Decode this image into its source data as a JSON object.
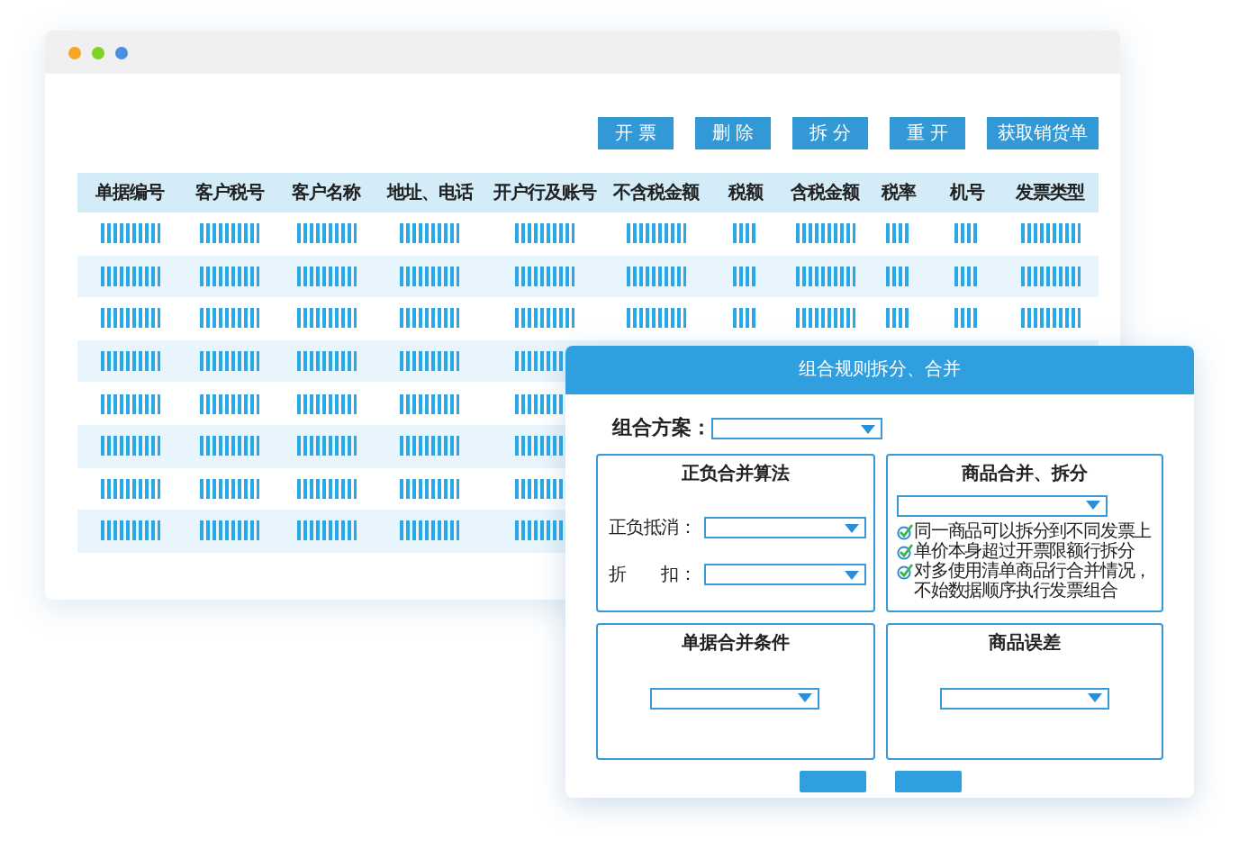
{
  "window": {
    "controls": [
      {
        "color": "#f5a623"
      },
      {
        "color": "#7ed321"
      },
      {
        "color": "#4a90e2"
      }
    ]
  },
  "toolbar": {
    "buttons": [
      "开 票",
      "删 除",
      "拆 分",
      "重 开",
      "获取销货单"
    ]
  },
  "table": {
    "columns": [
      "单据编号",
      "客户税号",
      "客户名称",
      "地址、电话",
      "开户行及账号",
      "不含税金额",
      "税额",
      "含税金额",
      "税率",
      "机号",
      "发票类型"
    ],
    "rows": [
      {
        "kind": "masked"
      },
      {
        "kind": "masked"
      },
      {
        "kind": "masked"
      },
      {
        "kind": "masked"
      },
      {
        "kind": "masked"
      },
      {
        "kind": "masked"
      },
      {
        "kind": "masked"
      },
      {
        "kind": "masked"
      }
    ]
  },
  "dialog": {
    "title": "组合规则拆分、合并",
    "scheme": {
      "label": "组合方案："
    },
    "panels": [
      {
        "title": "正负合并算法",
        "kind": "fields",
        "fields": [
          {
            "label": "正负抵消："
          },
          {
            "label": "折　　扣："
          }
        ]
      },
      {
        "title": "商品合并、拆分",
        "kind": "checklist",
        "options": [
          {
            "label": "同一商品可以拆分到不同发票上",
            "checked": true
          },
          {
            "label": "单价本身超过开票限额行拆分",
            "checked": true
          },
          {
            "label": "对多使用清单商品行合并情况，不始数据顺序执行发票组合",
            "checked": true
          }
        ]
      },
      {
        "title": "单据合并条件",
        "kind": "select"
      },
      {
        "title": "商品误差",
        "kind": "select"
      }
    ],
    "buttons": [
      {
        "kind": "button"
      },
      {
        "kind": "button"
      }
    ]
  }
}
